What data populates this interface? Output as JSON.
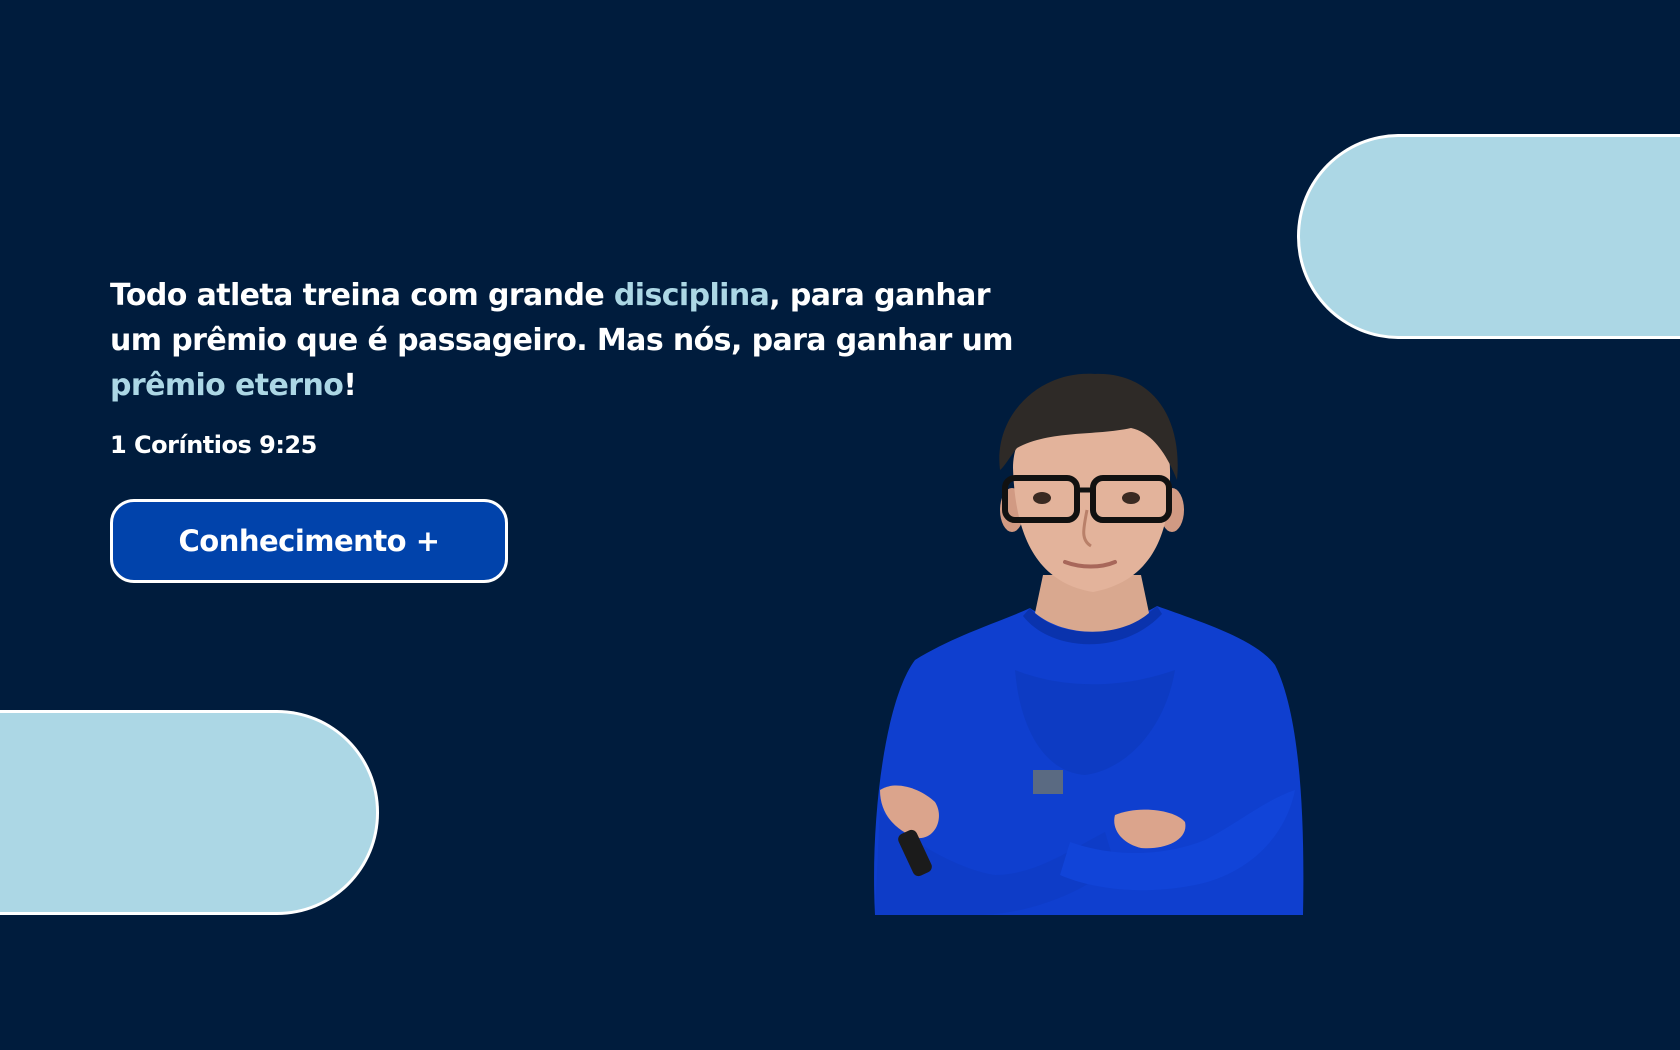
{
  "hero": {
    "quote_part1": "Todo atleta treina com grande ",
    "quote_accent1": "disciplina",
    "quote_part2": ", para ganhar um prêmio que é passageiro. Mas nós, para ganhar um ",
    "quote_accent2": "prêmio eterno",
    "quote_part3": "!",
    "reference": "1 Coríntios 9:25",
    "cta_label": "Conhecimento +"
  },
  "colors": {
    "background": "#001c3d",
    "accent": "#acd7e5",
    "button": "#0143ab",
    "text": "#ffffff"
  },
  "images": {
    "person": "person-photo"
  }
}
